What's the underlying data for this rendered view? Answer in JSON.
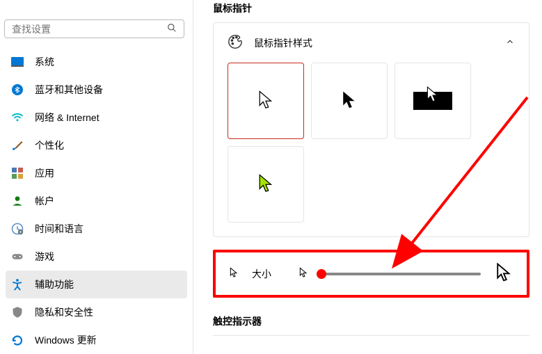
{
  "search": {
    "placeholder": "查找设置"
  },
  "sidebar": {
    "items": [
      {
        "label": "系统",
        "icon": "system"
      },
      {
        "label": "蓝牙和其他设备",
        "icon": "bluetooth"
      },
      {
        "label": "网络 & Internet",
        "icon": "network"
      },
      {
        "label": "个性化",
        "icon": "personalize"
      },
      {
        "label": "应用",
        "icon": "apps"
      },
      {
        "label": "帐户",
        "icon": "accounts"
      },
      {
        "label": "时间和语言",
        "icon": "time"
      },
      {
        "label": "游戏",
        "icon": "gaming"
      },
      {
        "label": "辅助功能",
        "icon": "accessibility",
        "active": true
      },
      {
        "label": "隐私和安全性",
        "icon": "privacy"
      },
      {
        "label": "Windows 更新",
        "icon": "update"
      }
    ]
  },
  "main": {
    "section_title": "鼠标指针",
    "style_header": "鼠标指针样式",
    "size_label": "大小",
    "touch_title": "触控指示器"
  }
}
